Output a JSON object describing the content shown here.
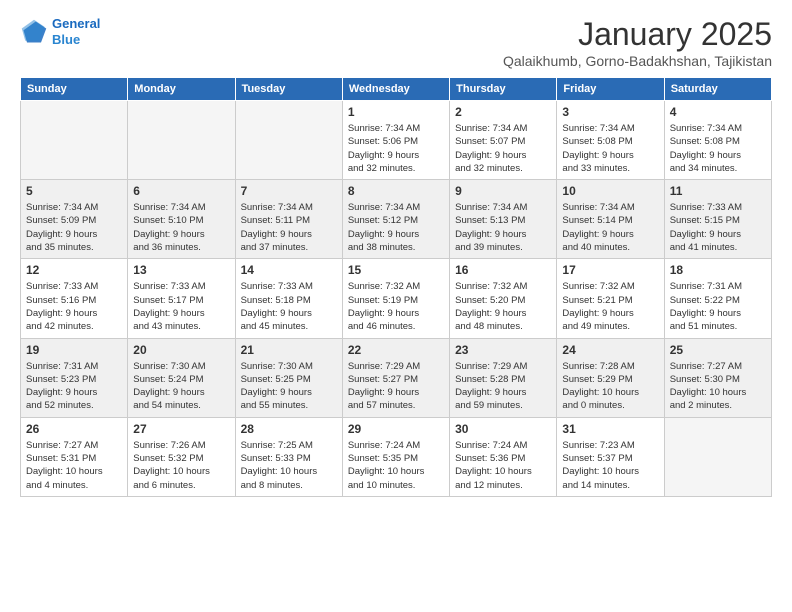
{
  "header": {
    "logo_line1": "General",
    "logo_line2": "Blue",
    "month": "January 2025",
    "location": "Qalaikhumb, Gorno-Badakhshan, Tajikistan"
  },
  "weekdays": [
    "Sunday",
    "Monday",
    "Tuesday",
    "Wednesday",
    "Thursday",
    "Friday",
    "Saturday"
  ],
  "weeks": [
    [
      {
        "num": "",
        "info": ""
      },
      {
        "num": "",
        "info": ""
      },
      {
        "num": "",
        "info": ""
      },
      {
        "num": "1",
        "info": "Sunrise: 7:34 AM\nSunset: 5:06 PM\nDaylight: 9 hours\nand 32 minutes."
      },
      {
        "num": "2",
        "info": "Sunrise: 7:34 AM\nSunset: 5:07 PM\nDaylight: 9 hours\nand 32 minutes."
      },
      {
        "num": "3",
        "info": "Sunrise: 7:34 AM\nSunset: 5:08 PM\nDaylight: 9 hours\nand 33 minutes."
      },
      {
        "num": "4",
        "info": "Sunrise: 7:34 AM\nSunset: 5:08 PM\nDaylight: 9 hours\nand 34 minutes."
      }
    ],
    [
      {
        "num": "5",
        "info": "Sunrise: 7:34 AM\nSunset: 5:09 PM\nDaylight: 9 hours\nand 35 minutes."
      },
      {
        "num": "6",
        "info": "Sunrise: 7:34 AM\nSunset: 5:10 PM\nDaylight: 9 hours\nand 36 minutes."
      },
      {
        "num": "7",
        "info": "Sunrise: 7:34 AM\nSunset: 5:11 PM\nDaylight: 9 hours\nand 37 minutes."
      },
      {
        "num": "8",
        "info": "Sunrise: 7:34 AM\nSunset: 5:12 PM\nDaylight: 9 hours\nand 38 minutes."
      },
      {
        "num": "9",
        "info": "Sunrise: 7:34 AM\nSunset: 5:13 PM\nDaylight: 9 hours\nand 39 minutes."
      },
      {
        "num": "10",
        "info": "Sunrise: 7:34 AM\nSunset: 5:14 PM\nDaylight: 9 hours\nand 40 minutes."
      },
      {
        "num": "11",
        "info": "Sunrise: 7:33 AM\nSunset: 5:15 PM\nDaylight: 9 hours\nand 41 minutes."
      }
    ],
    [
      {
        "num": "12",
        "info": "Sunrise: 7:33 AM\nSunset: 5:16 PM\nDaylight: 9 hours\nand 42 minutes."
      },
      {
        "num": "13",
        "info": "Sunrise: 7:33 AM\nSunset: 5:17 PM\nDaylight: 9 hours\nand 43 minutes."
      },
      {
        "num": "14",
        "info": "Sunrise: 7:33 AM\nSunset: 5:18 PM\nDaylight: 9 hours\nand 45 minutes."
      },
      {
        "num": "15",
        "info": "Sunrise: 7:32 AM\nSunset: 5:19 PM\nDaylight: 9 hours\nand 46 minutes."
      },
      {
        "num": "16",
        "info": "Sunrise: 7:32 AM\nSunset: 5:20 PM\nDaylight: 9 hours\nand 48 minutes."
      },
      {
        "num": "17",
        "info": "Sunrise: 7:32 AM\nSunset: 5:21 PM\nDaylight: 9 hours\nand 49 minutes."
      },
      {
        "num": "18",
        "info": "Sunrise: 7:31 AM\nSunset: 5:22 PM\nDaylight: 9 hours\nand 51 minutes."
      }
    ],
    [
      {
        "num": "19",
        "info": "Sunrise: 7:31 AM\nSunset: 5:23 PM\nDaylight: 9 hours\nand 52 minutes."
      },
      {
        "num": "20",
        "info": "Sunrise: 7:30 AM\nSunset: 5:24 PM\nDaylight: 9 hours\nand 54 minutes."
      },
      {
        "num": "21",
        "info": "Sunrise: 7:30 AM\nSunset: 5:25 PM\nDaylight: 9 hours\nand 55 minutes."
      },
      {
        "num": "22",
        "info": "Sunrise: 7:29 AM\nSunset: 5:27 PM\nDaylight: 9 hours\nand 57 minutes."
      },
      {
        "num": "23",
        "info": "Sunrise: 7:29 AM\nSunset: 5:28 PM\nDaylight: 9 hours\nand 59 minutes."
      },
      {
        "num": "24",
        "info": "Sunrise: 7:28 AM\nSunset: 5:29 PM\nDaylight: 10 hours\nand 0 minutes."
      },
      {
        "num": "25",
        "info": "Sunrise: 7:27 AM\nSunset: 5:30 PM\nDaylight: 10 hours\nand 2 minutes."
      }
    ],
    [
      {
        "num": "26",
        "info": "Sunrise: 7:27 AM\nSunset: 5:31 PM\nDaylight: 10 hours\nand 4 minutes."
      },
      {
        "num": "27",
        "info": "Sunrise: 7:26 AM\nSunset: 5:32 PM\nDaylight: 10 hours\nand 6 minutes."
      },
      {
        "num": "28",
        "info": "Sunrise: 7:25 AM\nSunset: 5:33 PM\nDaylight: 10 hours\nand 8 minutes."
      },
      {
        "num": "29",
        "info": "Sunrise: 7:24 AM\nSunset: 5:35 PM\nDaylight: 10 hours\nand 10 minutes."
      },
      {
        "num": "30",
        "info": "Sunrise: 7:24 AM\nSunset: 5:36 PM\nDaylight: 10 hours\nand 12 minutes."
      },
      {
        "num": "31",
        "info": "Sunrise: 7:23 AM\nSunset: 5:37 PM\nDaylight: 10 hours\nand 14 minutes."
      },
      {
        "num": "",
        "info": ""
      }
    ]
  ]
}
